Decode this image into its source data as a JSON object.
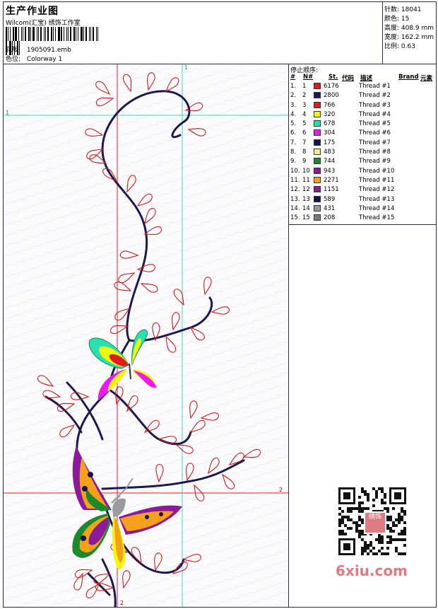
{
  "header": {
    "title": "生产作业图",
    "brand": "Wilcom(汇宝) 绣饰工作室",
    "design_label": "花版:",
    "design_value": "1905091.emb",
    "colorway_label": "色位:",
    "colorway_value": "Colorway 1"
  },
  "stats": {
    "stitches": "针数: 18041",
    "colors": "颜色: 15",
    "height": "高度: 408.9 mm",
    "width": "宽度: 162.2 mm",
    "scale": "比例: 0.63"
  },
  "guides": {
    "v1": "1",
    "h1": "1",
    "h2": "2",
    "v2": "2"
  },
  "thread_panel": {
    "title": "停止顺序:",
    "headers": [
      "#",
      "N#",
      "St.",
      "代码",
      "描述",
      "Brand",
      "元素"
    ],
    "rows": [
      {
        "n": "1.",
        "num": "1",
        "color": "#e01a1a",
        "code": "6176",
        "desc": "Thread #1"
      },
      {
        "n": "2.",
        "num": "2",
        "color": "#1a1a5a",
        "code": "2800",
        "desc": "Thread #2"
      },
      {
        "n": "3.",
        "num": "3",
        "color": "#e01a1a",
        "code": "766",
        "desc": "Thread #3"
      },
      {
        "n": "4.",
        "num": "4",
        "color": "#f5f50a",
        "code": "320",
        "desc": "Thread #4"
      },
      {
        "n": "5.",
        "num": "5",
        "color": "#1ae0b0",
        "code": "678",
        "desc": "Thread #5"
      },
      {
        "n": "6.",
        "num": "6",
        "color": "#f01af0",
        "code": "304",
        "desc": "Thread #6"
      },
      {
        "n": "7.",
        "num": "7",
        "color": "#141450",
        "code": "175",
        "desc": "Thread #7"
      },
      {
        "n": "8.",
        "num": "8",
        "color": "#f5f080",
        "code": "483",
        "desc": "Thread #8"
      },
      {
        "n": "9.",
        "num": "9",
        "color": "#1a8a2a",
        "code": "744",
        "desc": "Thread #9"
      },
      {
        "n": "10.",
        "num": "10",
        "color": "#8a1a9a",
        "code": "943",
        "desc": "Thread #10"
      },
      {
        "n": "11.",
        "num": "11",
        "color": "#f5a01a",
        "code": "2271",
        "desc": "Thread #11"
      },
      {
        "n": "12.",
        "num": "12",
        "color": "#8a1a9a",
        "code": "1151",
        "desc": "Thread #12"
      },
      {
        "n": "13.",
        "num": "13",
        "color": "#141450",
        "code": "589",
        "desc": "Thread #13"
      },
      {
        "n": "14.",
        "num": "14",
        "color": "#9a9aa0",
        "code": "431",
        "desc": "Thread #14"
      },
      {
        "n": "15.",
        "num": "15",
        "color": "#7a7a80",
        "code": "208",
        "desc": "Thread #15"
      }
    ]
  },
  "watermark": {
    "logo": "6xiu.com",
    "qr_stamp": "绣饰"
  }
}
